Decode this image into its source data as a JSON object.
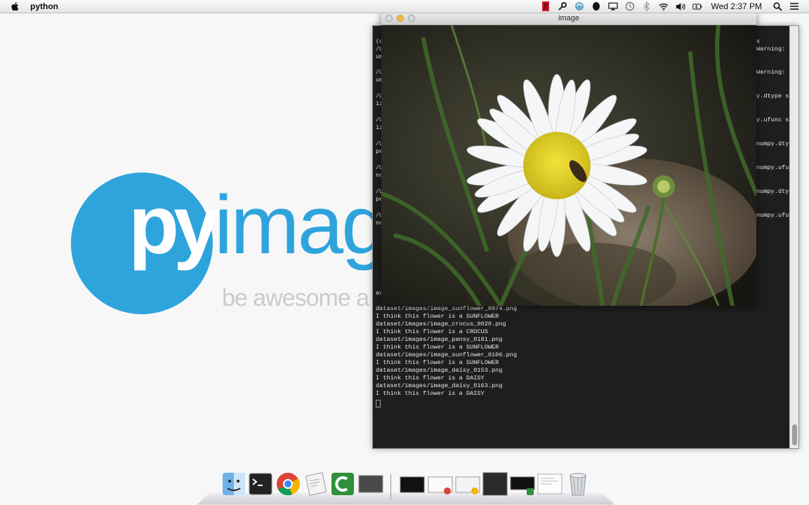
{
  "menubar": {
    "app_name": "python",
    "clock": "Wed 2:37 PM",
    "status_icons": [
      "red-flag-icon",
      "wrench-icon",
      "recycle-icon",
      "evernote-icon",
      "airplay-icon",
      "time-machine-icon",
      "bluetooth-icon",
      "wifi-icon",
      "volume-icon",
      "battery-icon",
      "search-icon",
      "list-icon"
    ]
  },
  "desktop_logo": {
    "brand_left": "py",
    "brand_right": "imag",
    "tagline": "be awesome a",
    "color": "#2fa4dc"
  },
  "image_window": {
    "title": "image"
  },
  "terminal": {
    "left_fragments": [
      "(c",
      "/U",
      "um",
      "/U",
      "um",
      "/U",
      "iz",
      "/U",
      "iz",
      "/U",
      "pe",
      "/U",
      "nc",
      "/U",
      "pe",
      "/U",
      "nc",
      "av"
    ],
    "right_fragments": [
      "s",
      "Warning: n",
      "Warning: n",
      "y.dtype s",
      "y.ufunc s",
      "numpy.dty",
      "numpy.ufu",
      "numpy.dty",
      "numpy.ufu"
    ],
    "output_lines": [
      "dataset/images/image_sunflower_0074.png",
      "I think this flower is a SUNFLOWER",
      "dataset/images/image_crocus_0020.png",
      "I think this flower is a CROCUS",
      "dataset/images/image_pansy_0181.png",
      "I think this flower is a SUNFLOWER",
      "dataset/images/image_sunflower_0106.png",
      "I think this flower is a SUNFLOWER",
      "dataset/images/image_daisy_0153.png",
      "I think this flower is a DAISY",
      "dataset/images/image_daisy_0163.png",
      "I think this flower is a DAISY"
    ]
  },
  "dock": {
    "items": [
      "finder-icon",
      "terminal-icon",
      "chrome-icon",
      "preview-icon",
      "camtasia-icon",
      "window-thumbnail-icon",
      "window-thumbnail-icon",
      "window-thumbnail-icon",
      "window-thumbnail-icon",
      "window-thumbnail-icon",
      "window-thumbnail-icon",
      "window-thumbnail-icon",
      "trash-icon"
    ]
  }
}
